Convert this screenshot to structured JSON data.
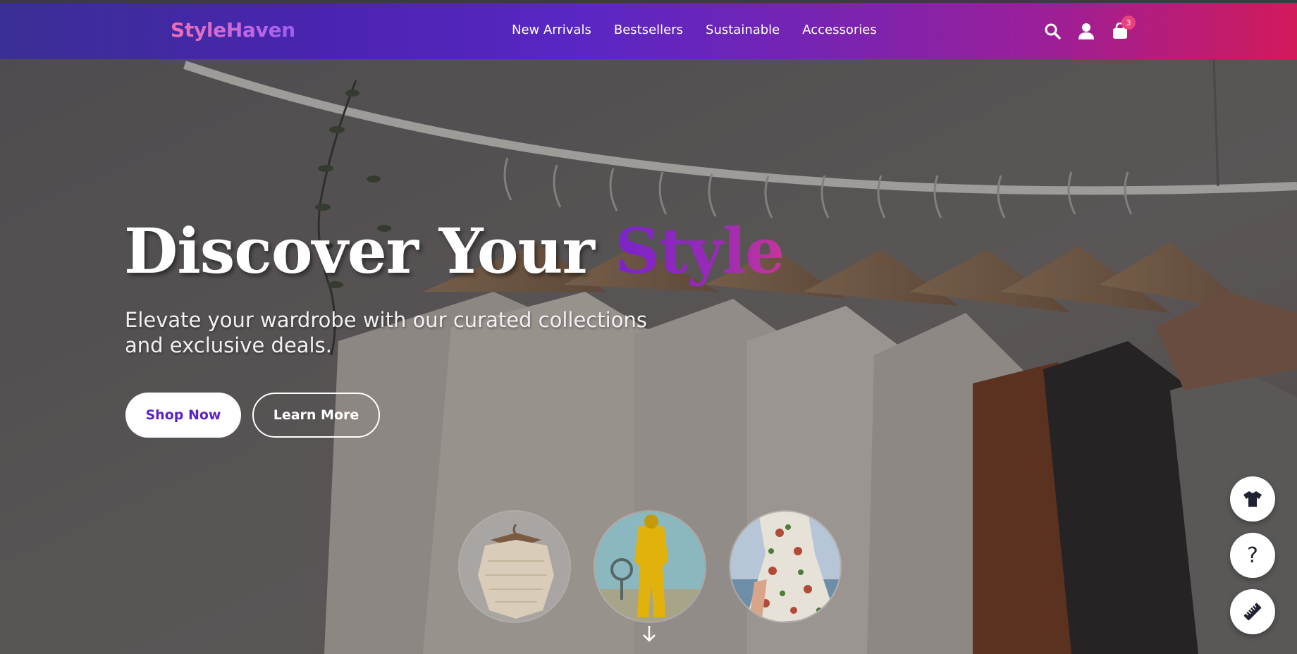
{
  "brand": {
    "logo": "StyleHaven"
  },
  "nav": {
    "links": [
      "New Arrivals",
      "Bestsellers",
      "Sustainable",
      "Accessories"
    ],
    "icons": [
      "search-icon",
      "user-icon",
      "shopping-bag-icon"
    ],
    "cart_count": "3"
  },
  "hero": {
    "title_main": "Discover Your ",
    "title_accent": "Style",
    "subtitle": "Elevate your wardrobe with our curated collections and exclusive deals.",
    "primary_button": "Shop Now",
    "secondary_button": "Learn More"
  },
  "thumbnails": [
    "knit-top-thumbnail",
    "yellow-tracksuit-thumbnail",
    "floral-dress-thumbnail"
  ],
  "floating_actions": {
    "help_label": "?",
    "icons": [
      "tshirt-icon",
      "help-icon",
      "ruler-icon"
    ]
  },
  "colors": {
    "nav_gradient_start": "#3a2f95",
    "nav_gradient_end": "#d21a5a",
    "accent_purple": "#5a22c8",
    "badge_pink": "#e8437d"
  }
}
